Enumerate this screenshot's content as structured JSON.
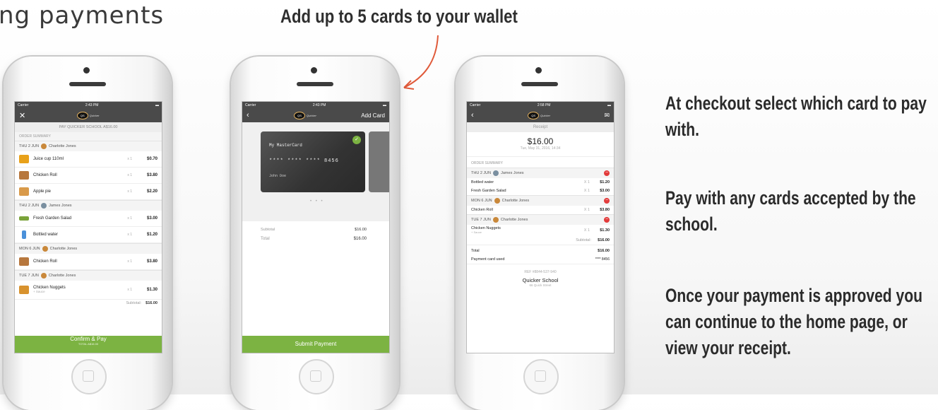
{
  "heading": "ng payments",
  "top_note": "Add up to 5 cards to your wallet",
  "side_text": [
    "At checkout select which card to pay with.",
    "Pay with any cards accepted by the school.",
    "Once your payment is approved you can continue to the home page, or view your receipt."
  ],
  "phone1": {
    "carrier": "Carrier",
    "time": "2:43 PM",
    "logo": "QS",
    "pay_label": "PAY QUICKER SCHOOL A$16.00",
    "order_summary": "ORDER SUMMARY",
    "days": [
      {
        "date": "THU 2 JUN",
        "name": "Charlotte Jones",
        "items": [
          {
            "name": "Juice cup 110ml",
            "qty": "x 1",
            "price": "$0.70"
          },
          {
            "name": "Chicken Roll",
            "qty": "x 1",
            "price": "$3.80"
          },
          {
            "name": "Apple pie",
            "qty": "x 1",
            "price": "$2.20"
          }
        ]
      },
      {
        "date": "THU 2 JUN",
        "name": "James Jones",
        "items": [
          {
            "name": "Fresh Garden Salad",
            "qty": "x 1",
            "price": "$3.00"
          },
          {
            "name": "Bottled water",
            "qty": "x 1",
            "price": "$1.20"
          }
        ]
      },
      {
        "date": "MON 6 JUN",
        "name": "Charlotte Jones",
        "items": [
          {
            "name": "Chicken Roll",
            "qty": "x 1",
            "price": "$3.80"
          }
        ]
      },
      {
        "date": "TUE 7 JUN",
        "name": "Charlotte Jones",
        "items": [
          {
            "name": "Chicken Nuggets",
            "qty": "x 1",
            "price": "$1.30"
          }
        ]
      }
    ],
    "sauce_note": "+ Sauce",
    "subtotal_label": "Subtotal:",
    "subtotal": "$16.00",
    "confirm": "Confirm & Pay",
    "confirm_sub": "TOTAL A$16.00"
  },
  "phone2": {
    "carrier": "Carrier",
    "time": "2:43 PM",
    "logo": "QS",
    "add_card": "Add Card",
    "card_name": "My MasterCard",
    "card_number": "**** **** **** 8456",
    "card_holder": "John Doe",
    "pager": "• • •",
    "subtotal_label": "Subtotal",
    "subtotal": "$16.00",
    "total_label": "Total",
    "total": "$16.00",
    "submit": "Submit Payment"
  },
  "phone3": {
    "carrier": "Carrier",
    "time": "2:58 PM",
    "logo": "QS",
    "title": "Receipt",
    "amount": "$16.00",
    "date": "Tue, May 31, 2016, 14:34",
    "order_summary": "ORDER SUMMARY",
    "day1": "THU 2 JUN",
    "day1_name": "James Jones",
    "r1": {
      "name": "Bottled water",
      "qty": "X 1",
      "price": "$1.20"
    },
    "r2": {
      "name": "Fresh Garden Salad",
      "qty": "X 1",
      "price": "$3.00"
    },
    "day2": "MON 6 JUN",
    "day2_name": "Charlotte Jones",
    "r3": {
      "name": "Chicken Roll",
      "qty": "X 1",
      "price": "$3.80"
    },
    "day3": "TUE 7 JUN",
    "day3_name": "Charlotte Jones",
    "r4": {
      "name": "Chicken Nuggets",
      "qty": "X 1",
      "price": "$1.30"
    },
    "sauce_note": "+ Sauce",
    "subtotal_label": "Subtotal:",
    "subtotal": "$16.00",
    "total_label": "Total",
    "total": "$16.00",
    "card_used_label": "Payment card used",
    "card_used": "**** 8456",
    "ref": "REF #8844-537-940",
    "school": "Quicker School",
    "address": "66 Quick Street"
  }
}
